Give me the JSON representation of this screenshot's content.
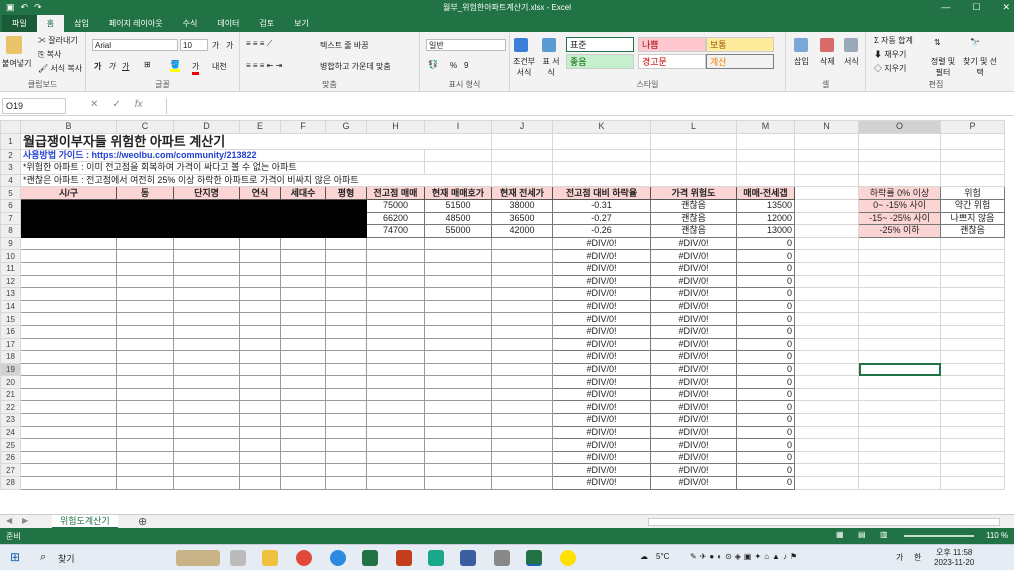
{
  "window": {
    "title": "월부_위험한아파트계산기.xlsx - Excel",
    "min": "—",
    "max": "☐",
    "close": "✕"
  },
  "tabs": [
    "파일",
    "홈",
    "삽입",
    "페이지 레이아웃",
    "수식",
    "데이터",
    "검토",
    "보기"
  ],
  "ribbon": {
    "clipboard": {
      "paste": "붙여넣기",
      "cut": "잘라내기",
      "copy": "복사",
      "format_painter": "서식 복사",
      "label": "클립보드"
    },
    "font": {
      "name": "Arial",
      "size": "10",
      "label": "글꼴",
      "grow": "가",
      "shrink": "가",
      "bold": "가",
      "italic": "가",
      "underline": "가",
      "fontcolor": "가",
      "phonetic": "내천"
    },
    "alignment": {
      "wrap": "텍스트 줄 바꿈",
      "merge": "병합하고 가운데 맞춤",
      "label": "맞춤"
    },
    "number": {
      "format": "일반",
      "percent": "%",
      "comma": "9",
      "label": "표시 형식"
    },
    "styles": {
      "cond": "조건부 서식",
      "table": "표 서식",
      "normal": "표준",
      "bad": "나쁨",
      "neutral": "보통",
      "good": "좋음",
      "warning": "경고문",
      "calc": "계산",
      "label": "스타일"
    },
    "cells": {
      "insert": "삽입",
      "delete": "삭제",
      "format": "서식",
      "label": "셀"
    },
    "editing": {
      "autosum": "자동 합계",
      "fill": "채우기",
      "clear": "지우기",
      "sort": "정렬 및 필터",
      "find": "찾기 및 선택",
      "label": "편집"
    }
  },
  "formula_bar": {
    "name_box": "O19",
    "fx": "fx",
    "cancel": "✕",
    "enter": "✓",
    "value": ""
  },
  "columns": [
    "A",
    "B",
    "C",
    "D",
    "E",
    "F",
    "G",
    "H",
    "I",
    "J",
    "K",
    "L",
    "M",
    "N",
    "O",
    "P"
  ],
  "sheet": {
    "title": "월급쟁이부자들 위험한 아파트 계산기",
    "guide_label": "사용방법 가이드 : ",
    "guide_url": "https://weolbu.com/community/213822",
    "note1": "*위험한 아파트 : 이미 전고점을 회복하여 가격이 싸다고 볼 수 없는 아파트",
    "note2": "*괜찮은 아파트 : 전고점에서 여전히 25% 이상 하락한 아파트로 가격이 비싸지 않은 아파트",
    "headers": [
      "시/구",
      "동",
      "단지명",
      "연식",
      "세대수",
      "평형",
      "전고점 매매",
      "현재 매매호가",
      "현재 전세가",
      "전고점 대비 하락율",
      "가격 위험도",
      "매매-전세갭"
    ],
    "data_rows": [
      {
        "peak": "75000",
        "ask": "51500",
        "jeonse": "38000",
        "drop": "-0.31",
        "risk": "괜찮음",
        "gap": "13500"
      },
      {
        "peak": "66200",
        "ask": "48500",
        "jeonse": "36500",
        "drop": "-0.27",
        "risk": "괜찮음",
        "gap": "12000"
      },
      {
        "peak": "74700",
        "ask": "55000",
        "jeonse": "42000",
        "drop": "-0.26",
        "risk": "괜찮음",
        "gap": "13000"
      }
    ],
    "empty_drop": "#DIV/0!",
    "empty_risk": "#DIV/0!",
    "empty_gap": "0",
    "legend": [
      {
        "range": "하락률 0% 이상",
        "label": "위험"
      },
      {
        "range": "0~ -15% 사이",
        "label": "약간 위험"
      },
      {
        "range": "-15~ -25% 사이",
        "label": "나쁘지 않음"
      },
      {
        "range": "-25% 이하",
        "label": "괜찮음"
      }
    ]
  },
  "sheet_tab": "위험도계산기",
  "status": {
    "ready": "준비",
    "zoom": "110 %"
  },
  "taskbar": {
    "search": "찾기",
    "weather": "5°C",
    "time": "오후 11:58",
    "date": "2023-11-20",
    "ime": "가",
    "ime2": "한"
  },
  "colors": {
    "excel_green": "#217346",
    "header_pink": "#fbd4d4",
    "link_blue": "#1f3fd1"
  }
}
